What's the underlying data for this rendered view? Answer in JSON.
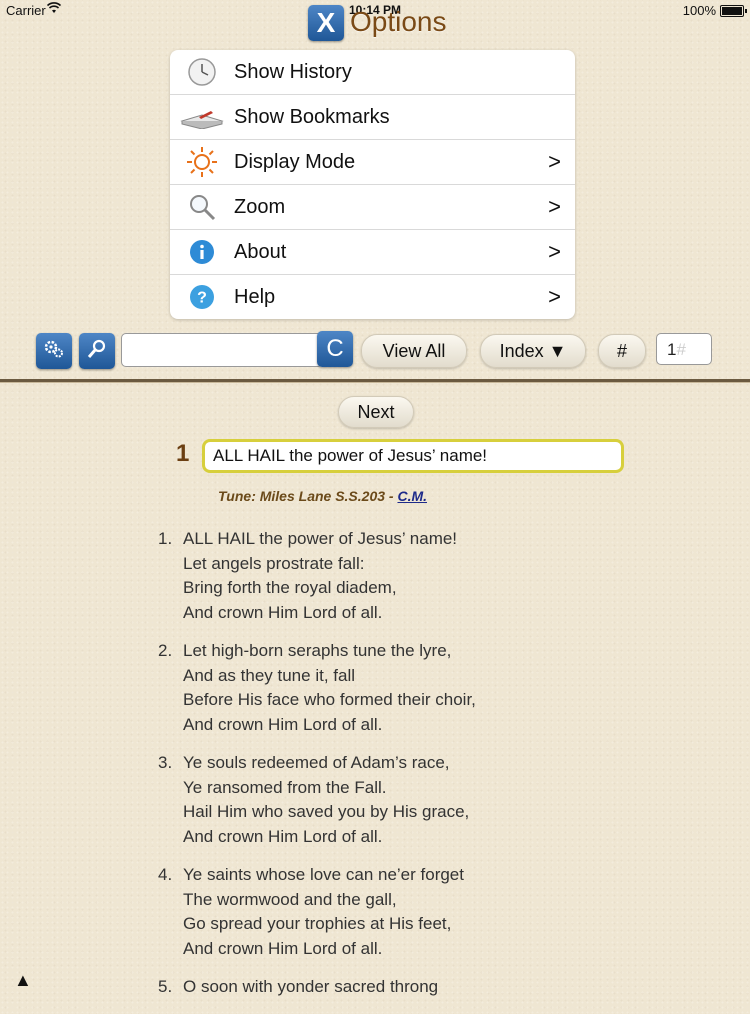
{
  "status_bar": {
    "carrier": "Carrier",
    "time": "10:14 PM",
    "battery": "100%"
  },
  "header": {
    "close_label": "X",
    "title": "Options"
  },
  "menu": {
    "items": [
      {
        "label": "Show History",
        "icon": "clock-icon",
        "chevron": ""
      },
      {
        "label": "Show Bookmarks",
        "icon": "book-icon",
        "chevron": ""
      },
      {
        "label": "Display Mode",
        "icon": "sun-icon",
        "chevron": ">"
      },
      {
        "label": "Zoom",
        "icon": "magnifier-icon",
        "chevron": ">"
      },
      {
        "label": "About",
        "icon": "info-icon",
        "chevron": ">"
      },
      {
        "label": "Help",
        "icon": "help-icon",
        "chevron": ">"
      }
    ]
  },
  "toolbar": {
    "search_value": "",
    "clear_label": "C",
    "view_all_label": "View All",
    "index_label": "Index ▼",
    "hash_label": "#",
    "number_value": "1",
    "number_placeholder": "#"
  },
  "hymn": {
    "next_label": "Next",
    "number": "1",
    "title": "ALL HAIL the power of Jesus’ name!",
    "tune_label": "Tune: Miles Lane S.S.203 - ",
    "meter_link": "C.M.",
    "verses": [
      {
        "num": "1.",
        "lines": [
          "ALL HAIL the power of Jesus’ name!",
          "Let angels prostrate fall:",
          "Bring forth the royal diadem,",
          "And crown Him Lord of all."
        ]
      },
      {
        "num": "2.",
        "lines": [
          "Let high-born seraphs tune the lyre,",
          "And as they tune it, fall",
          "Before His face who formed their choir,",
          "And crown Him Lord of all."
        ]
      },
      {
        "num": "3.",
        "lines": [
          "Ye souls redeemed of Adam’s race,",
          "Ye ransomed from the Fall.",
          "Hail Him who saved you by His grace,",
          "And crown Him Lord of all."
        ]
      },
      {
        "num": "4.",
        "lines": [
          "Ye saints whose love can ne’er forget",
          "The wormwood and the gall,",
          "Go spread your trophies at His feet,",
          "And crown Him Lord of all."
        ]
      },
      {
        "num": "5.",
        "lines": [
          "O soon with yonder sacred throng"
        ]
      }
    ]
  },
  "footer": {
    "scroll_top_label": "▲"
  }
}
